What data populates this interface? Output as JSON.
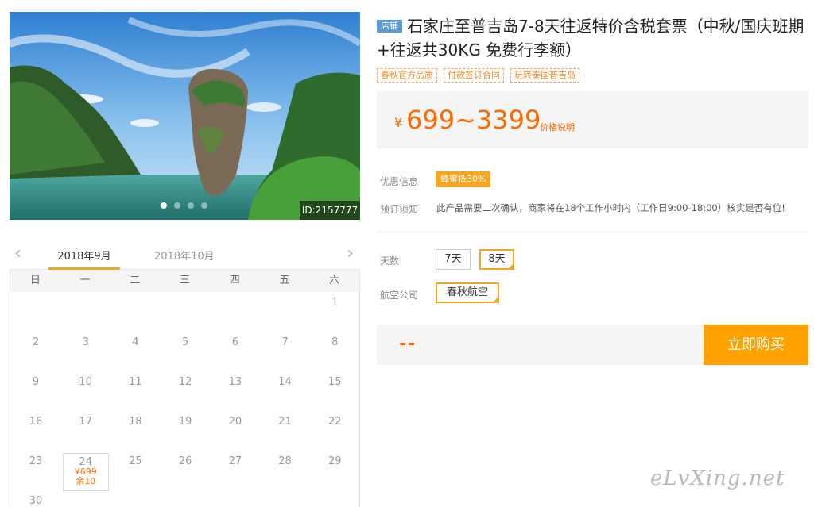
{
  "hero": {
    "image_id": "ID:2157777",
    "slide_count": 4,
    "active_slide": 1
  },
  "calendar": {
    "prev_icon": "chevron-left-icon",
    "next_icon": "chevron-right-icon",
    "months": [
      "2018年9月",
      "2018年10月"
    ],
    "active_month": "2018年9月",
    "weekdays": [
      "日",
      "一",
      "二",
      "三",
      "四",
      "五",
      "六"
    ],
    "first_weekday": 6,
    "days_in_month": 30,
    "available": [
      {
        "day": "24",
        "price": "¥699",
        "remaining": "余10"
      }
    ]
  },
  "product": {
    "shop_tag": "店铺",
    "title": "石家庄至普吉岛7-8天往返特价含税套票（中秋/国庆班期+往返共30KG 免费行李额）",
    "tags": [
      "春秋官方品质",
      "付款签订合同",
      "玩转泰国普吉岛"
    ],
    "price_currency": "¥",
    "price_range": "699~3399",
    "price_note": "价格说明",
    "promo_label": "优惠信息",
    "promo_badge": "蜂蜜抵30%",
    "notice_label": "预订须知",
    "notice_text": "此产品需要二次确认，商家将在18个工作小时内（工作日9:00-18:00）核实是否有位!"
  },
  "options": {
    "days_label": "天数",
    "days": [
      "7天",
      "8天"
    ],
    "days_selected": "8天",
    "airline_label": "航空公司",
    "airline": [
      "春秋航空"
    ],
    "airline_selected": "春秋航空"
  },
  "buy": {
    "price_placeholder": "--",
    "button": "立即购买"
  },
  "watermark": "eLvXing.net",
  "colors": {
    "accent": "#ff6a00",
    "button": "#ffa200",
    "selected_border": "#f5a623",
    "shop_tag": "#5b9bd5"
  }
}
